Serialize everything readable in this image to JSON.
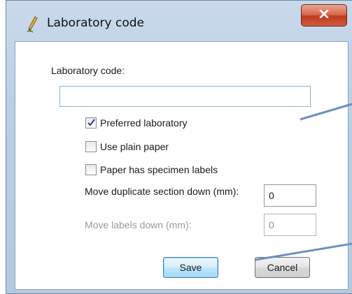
{
  "window": {
    "title": "Laboratory code",
    "close_glyph": "X"
  },
  "form": {
    "code_label": "Laboratory code:",
    "code_value": "",
    "preferred_label": "Preferred laboratory",
    "preferred_checked": true,
    "plain_paper_label": "Use plain paper",
    "plain_paper_checked": false,
    "specimen_labels_label": "Paper has specimen labels",
    "specimen_labels_checked": false,
    "duplicate_down_label": "Move duplicate section down (mm):",
    "duplicate_down_value": "0",
    "labels_down_label": "Move labels down (mm):",
    "labels_down_value": "0"
  },
  "buttons": {
    "save": "Save",
    "cancel": "Cancel"
  },
  "colors": {
    "frame": "#b9cfe4",
    "close_button": "#c03a1f",
    "annotation_arrow": "#6f8fc0"
  },
  "icons": {
    "title": "pencil-icon",
    "close": "close-icon",
    "check": "checkmark-icon"
  }
}
